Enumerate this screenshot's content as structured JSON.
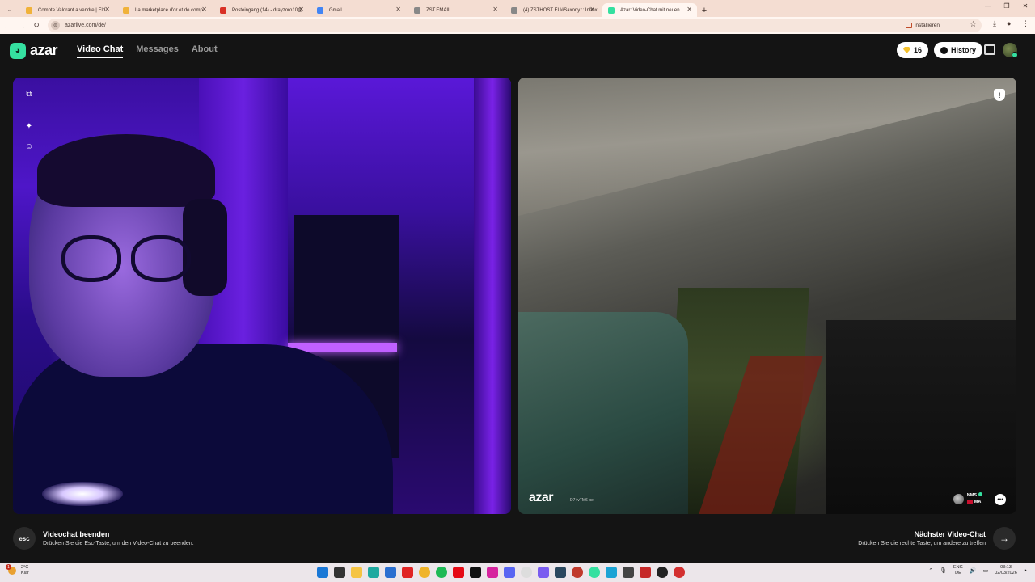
{
  "browser": {
    "tabs": [
      {
        "title": "Compte Valorant a vendre | Eld",
        "favicon_color": "#f0b23a",
        "active": false
      },
      {
        "title": "La marketplace d'or et de comp",
        "favicon_color": "#f0b23a",
        "active": false
      },
      {
        "title": "Posteingang (14) - drayzoro10@",
        "favicon_color": "#d93025",
        "active": false
      },
      {
        "title": "Gmail",
        "favicon_color": "#4285f4",
        "active": false
      },
      {
        "title": "ZST.EMAIL",
        "favicon_color": "#888888",
        "active": false
      },
      {
        "title": "(4) ZSTHOST EU#Saxony :: Inbox",
        "favicon_color": "#888888",
        "active": false
      },
      {
        "title": "Azar: Video-Chat mit neuen",
        "favicon_color": "#35e0a0",
        "active": true
      }
    ],
    "new_tab": "+",
    "url": "azarlive.com/de/",
    "install_label": "Installieren"
  },
  "header": {
    "logo_text": "azar",
    "nav": [
      {
        "label": "Video Chat",
        "active": true
      },
      {
        "label": "Messages",
        "active": false
      },
      {
        "label": "About",
        "active": false
      }
    ],
    "gems_count": "16",
    "history_label": "History"
  },
  "peer": {
    "watermark": "azar",
    "session_id": "D7+vTM6-xe",
    "name": "NMS",
    "country": "MA"
  },
  "footer": {
    "esc_key": "esc",
    "end_title": "Videochat beenden",
    "end_sub": "Drücken Sie die Esc-Taste, um den Video-Chat zu beenden.",
    "next_title": "Nächster Video-Chat",
    "next_sub": "Drücken Sie die rechte Taste, um andere zu treffen"
  },
  "taskbar": {
    "weather_temp": "2°C",
    "weather_desc": "Klar",
    "weather_badge": "1",
    "language": "ENG",
    "region": "DE",
    "time": "03:13",
    "date": "02/03/2026"
  },
  "colors": {
    "accent": "#35e0a0",
    "background": "#141414"
  }
}
